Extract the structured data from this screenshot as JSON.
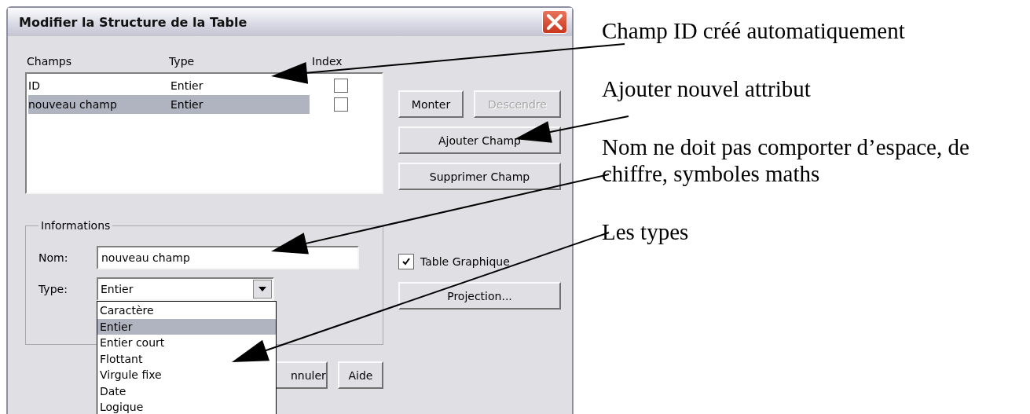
{
  "window": {
    "title": "Modifier la Structure de la Table"
  },
  "fields_list": {
    "columns": [
      "Champs",
      "Type",
      "Index"
    ],
    "rows": [
      {
        "name": "ID",
        "type": "Entier",
        "indexed": false,
        "selected": false
      },
      {
        "name": "nouveau champ",
        "type": "Entier",
        "indexed": false,
        "selected": true
      }
    ]
  },
  "side_buttons": [
    {
      "label": "Monter",
      "disabled": false
    },
    {
      "label": "Descendre",
      "disabled": true
    },
    {
      "label": "Ajouter Champ",
      "disabled": false
    },
    {
      "label": "Supprimer Champ",
      "disabled": false
    }
  ],
  "informations": {
    "title": "Informations",
    "name_label": "Nom:",
    "name_value": "nouveau champ",
    "type_label": "Type:",
    "type_value": "Entier",
    "type_options": [
      {
        "label": "Caractère",
        "selected": false
      },
      {
        "label": "Entier",
        "selected": true
      },
      {
        "label": "Entier court",
        "selected": false
      },
      {
        "label": "Flottant",
        "selected": false
      },
      {
        "label": "Virgule fixe",
        "selected": false
      },
      {
        "label": "Date",
        "selected": false
      },
      {
        "label": "Logique",
        "selected": false
      }
    ]
  },
  "table_graphique": {
    "label": "Table Graphique",
    "checked": true
  },
  "projection_button": "Projection...",
  "bottom_buttons": [
    "nnuler",
    "Aide"
  ],
  "annotations": [
    "Champ ID créé automatiquement",
    "Ajouter nouvel attribut",
    "Nom ne doit pas comporter d’espace, de chiffre, symboles maths",
    "Les types"
  ]
}
